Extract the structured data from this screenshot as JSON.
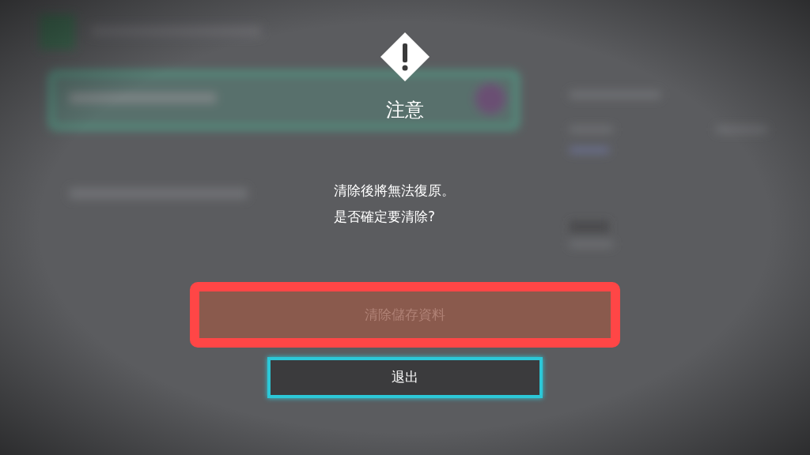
{
  "dialog": {
    "title": "注意",
    "message_lines": [
      "清除後將無法復原。",
      "是否確定要清除?"
    ],
    "buttons": [
      {
        "label": "清除儲存資料",
        "disabled": true,
        "focused": false,
        "highlighted": true
      },
      {
        "label": "退出",
        "disabled": false,
        "focused": true,
        "highlighted": false
      }
    ]
  }
}
